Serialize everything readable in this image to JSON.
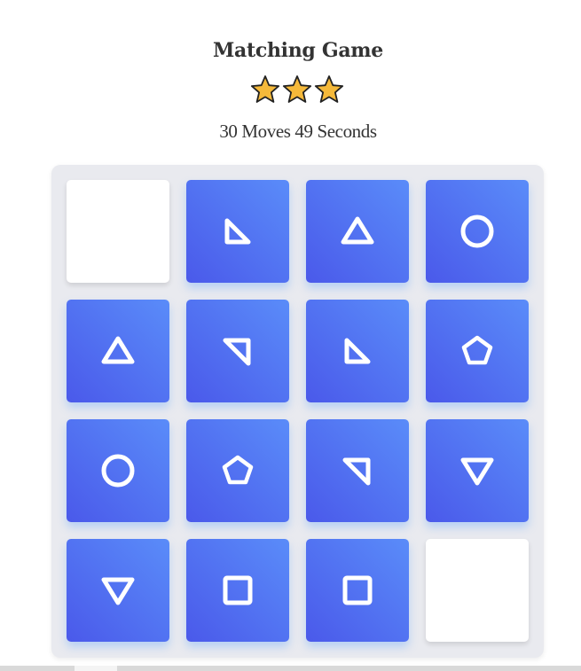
{
  "game": {
    "title": "Matching Game",
    "rating": {
      "stars_filled": 3,
      "stars_total": 3,
      "star_color": "#f5b93a"
    },
    "moves_label": "30 Moves",
    "seconds_label": "49 Seconds"
  },
  "theme": {
    "card_gradient": [
      "#4a59ea",
      "#5a8cf9"
    ],
    "card_back": "#ffffff",
    "board_bg": "#e9eaef"
  },
  "cards": [
    {
      "state": "facedown",
      "symbol": ""
    },
    {
      "state": "faceup",
      "symbol": "right-triangle-icon"
    },
    {
      "state": "faceup",
      "symbol": "triangle-up-icon"
    },
    {
      "state": "faceup",
      "symbol": "circle-icon"
    },
    {
      "state": "faceup",
      "symbol": "triangle-up-icon"
    },
    {
      "state": "faceup",
      "symbol": "right-triangle-flipped-icon"
    },
    {
      "state": "faceup",
      "symbol": "right-triangle-icon"
    },
    {
      "state": "faceup",
      "symbol": "pentagon-icon"
    },
    {
      "state": "faceup",
      "symbol": "circle-icon"
    },
    {
      "state": "faceup",
      "symbol": "pentagon-icon"
    },
    {
      "state": "faceup",
      "symbol": "right-triangle-flipped-icon"
    },
    {
      "state": "faceup",
      "symbol": "triangle-down-icon"
    },
    {
      "state": "faceup",
      "symbol": "triangle-down-icon"
    },
    {
      "state": "faceup",
      "symbol": "square-icon"
    },
    {
      "state": "faceup",
      "symbol": "square-icon"
    },
    {
      "state": "facedown",
      "symbol": ""
    }
  ]
}
